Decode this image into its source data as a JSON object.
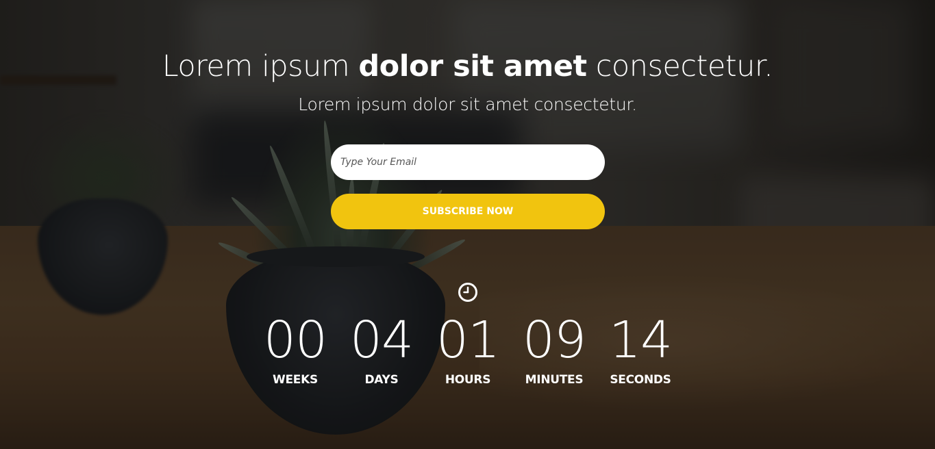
{
  "hero": {
    "headline_pre": "Lorem ipsum ",
    "headline_bold": "dolor sit amet",
    "headline_post": " consectetur.",
    "subheadline": "Lorem ipsum dolor sit amet consectetur."
  },
  "form": {
    "email_placeholder": "Type Your Email",
    "email_value": "",
    "subscribe_label": "SUBSCRIBE NOW"
  },
  "countdown": {
    "icon": "clock-icon",
    "units": [
      {
        "value": "00",
        "label": "WEEKS"
      },
      {
        "value": "04",
        "label": "DAYS"
      },
      {
        "value": "01",
        "label": "HOURS"
      },
      {
        "value": "09",
        "label": "MINUTES"
      },
      {
        "value": "14",
        "label": "SECONDS"
      }
    ]
  },
  "colors": {
    "accent": "#f1c40f",
    "text": "#ffffff",
    "input_bg": "#ffffff"
  }
}
